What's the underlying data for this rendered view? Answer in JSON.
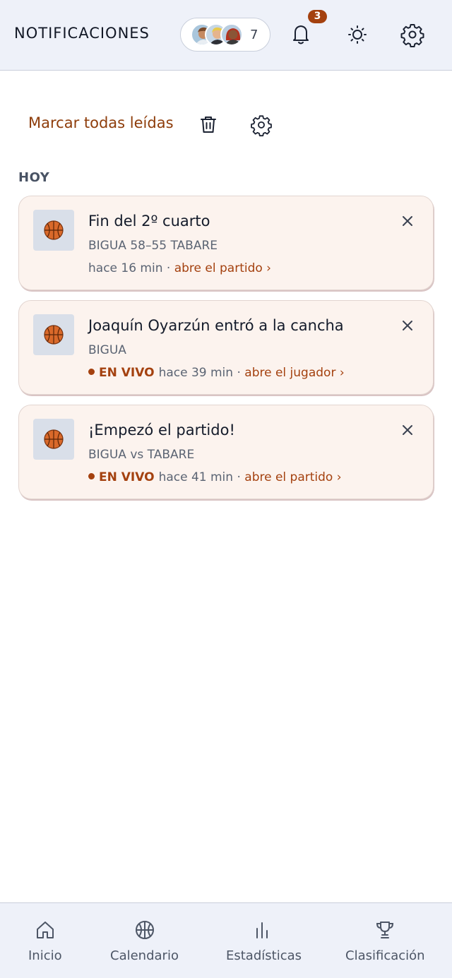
{
  "header": {
    "title": "NOTIFICACIONES",
    "avatar_count": "7",
    "notification_badge": "3",
    "icons": [
      "bell-icon",
      "sun-icon",
      "gear-icon"
    ]
  },
  "actions": {
    "mark_all_label": "Marcar todas leídas",
    "icons": [
      "trash-icon",
      "gear-icon"
    ]
  },
  "section_label": "HOY",
  "notifications": [
    {
      "title": "Fin del 2º cuarto",
      "subtitle": "BIGUA 58–55 TABARE",
      "live": "",
      "time": "hace 16 min",
      "separator": " · ",
      "link": "abre el partido ›",
      "icon": "basketball-icon"
    },
    {
      "title": "Joaquín Oyarzún entró a la cancha",
      "subtitle": "BIGUA",
      "live": "EN VIVO",
      "time": "hace 39 min",
      "separator": " · ",
      "link": "abre el jugador ›",
      "icon": "basketball-icon"
    },
    {
      "title": "¡Empezó el partido!",
      "subtitle": "BIGUA vs TABARE",
      "live": "EN VIVO",
      "time": "hace 41 min",
      "separator": " · ",
      "link": "abre el partido ›",
      "icon": "basketball-icon"
    }
  ],
  "bottom_nav": [
    {
      "label": "Inicio",
      "icon": "home-icon"
    },
    {
      "label": "Calendario",
      "icon": "basketball-outline-icon"
    },
    {
      "label": "Estadísticas",
      "icon": "bar-chart-icon"
    },
    {
      "label": "Clasificación",
      "icon": "trophy-icon"
    }
  ],
  "colors": {
    "accent": "#a4410f",
    "card_bg": "#fcf3ee",
    "header_bg": "#eef1f9"
  }
}
